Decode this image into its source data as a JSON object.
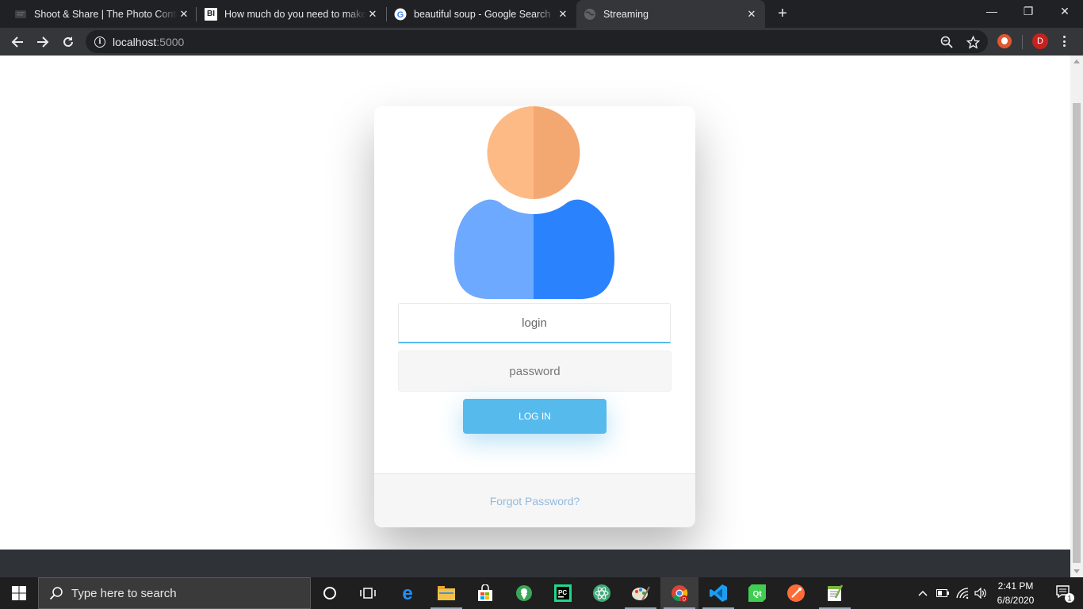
{
  "browser": {
    "tabs": [
      {
        "title": "Shoot & Share | The Photo Contest",
        "close": "✕"
      },
      {
        "title": "How much do you need to make to",
        "favicon": "BI",
        "close": "✕"
      },
      {
        "title": "beautiful soup - Google Search",
        "favicon": "G",
        "close": "✕"
      },
      {
        "title": "Streaming",
        "close": "✕"
      }
    ],
    "new_tab": "+",
    "window_controls": {
      "minimize": "—",
      "maximize": "❐",
      "close": "✕"
    },
    "url_host": "localhost",
    "url_port": ":5000",
    "avatar_initial": "D"
  },
  "page": {
    "login_placeholder": "login",
    "password_placeholder": "password",
    "login_button": "LOG IN",
    "forgot_password": "Forgot Password?"
  },
  "taskbar": {
    "search_placeholder": "Type here to search",
    "time": "2:41 PM",
    "date": "6/8/2020",
    "notification_count": "1",
    "apps": [
      "cortana",
      "task-view",
      "edge",
      "file-explorer",
      "store",
      "maps",
      "pycharm",
      "atom",
      "paint",
      "chrome",
      "vscode",
      "qt",
      "postman",
      "notepad-plus"
    ]
  },
  "colors": {
    "accent": "#56baed",
    "link": "#92badd",
    "head_left": "#fdba85",
    "head_right": "#f4a871",
    "body_left": "#6ca9ff",
    "body_right": "#2b82fd"
  }
}
